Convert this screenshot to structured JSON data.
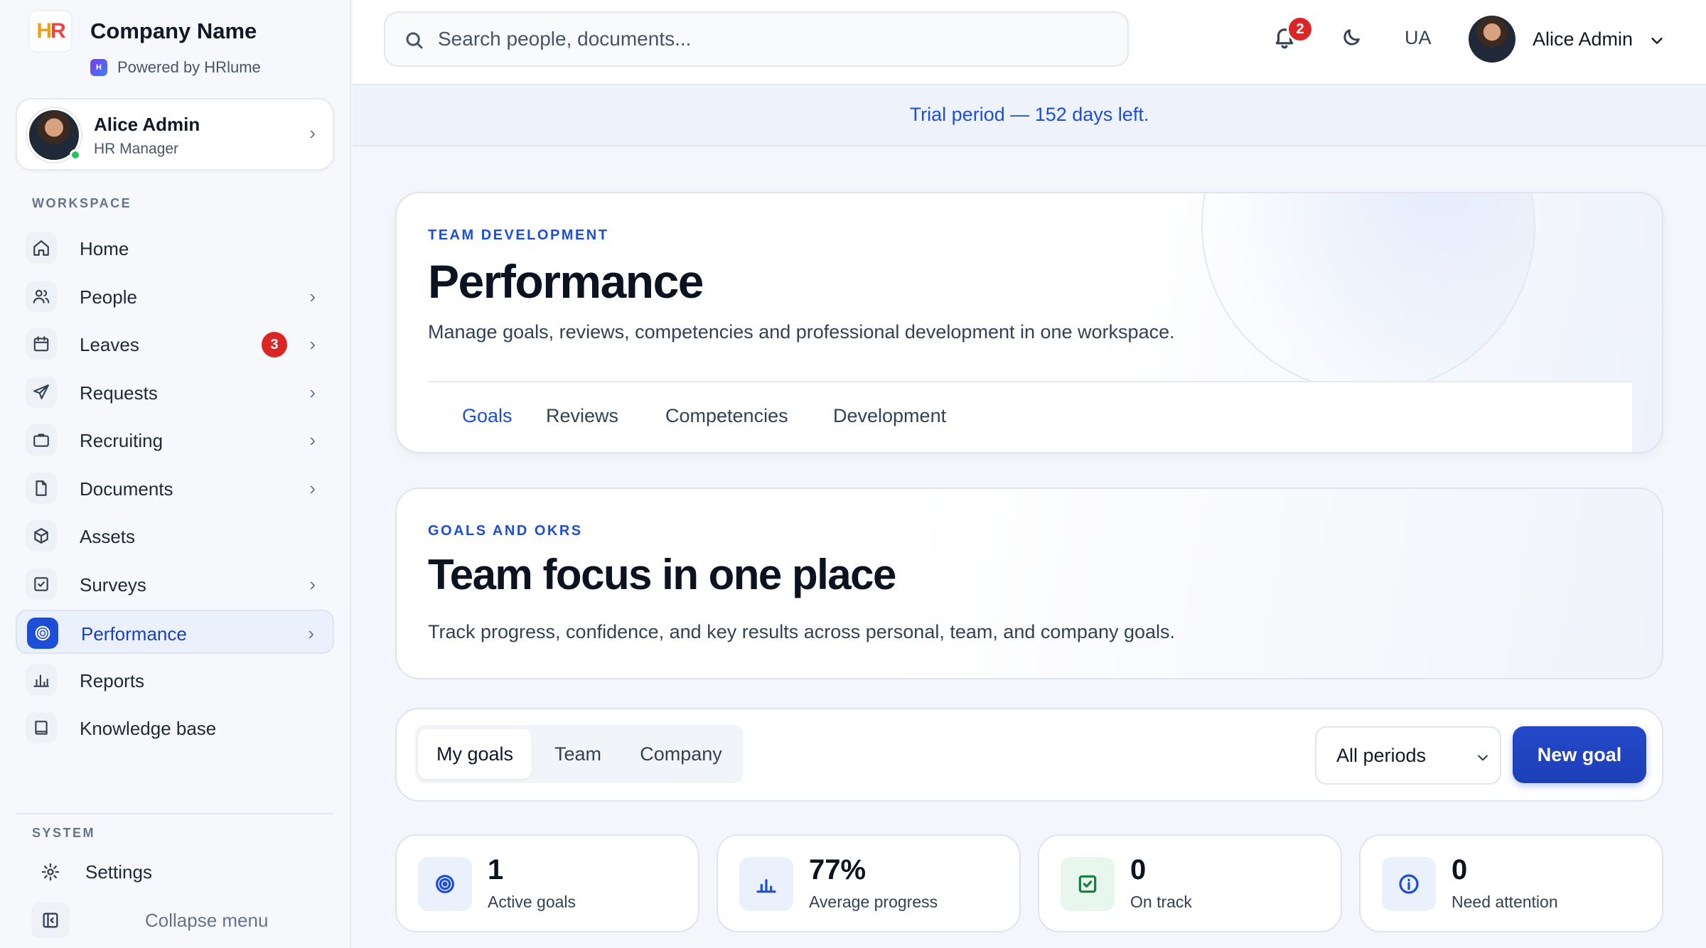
{
  "brand": {
    "logo_text": "HR",
    "name": "Company Name",
    "powered_by": "Powered by HRlume"
  },
  "sidebar": {
    "user": {
      "name": "Alice Admin",
      "role": "HR Manager"
    },
    "workspace_label": "WORKSPACE",
    "items": [
      {
        "label": "Home",
        "icon": "home-icon"
      },
      {
        "label": "People",
        "icon": "people-icon"
      },
      {
        "label": "Leaves",
        "icon": "calendar-icon",
        "badge": "3"
      },
      {
        "label": "Requests",
        "icon": "send-icon"
      },
      {
        "label": "Recruiting",
        "icon": "briefcase-icon"
      },
      {
        "label": "Documents",
        "icon": "document-icon"
      },
      {
        "label": "Assets",
        "icon": "box-icon"
      },
      {
        "label": "Surveys",
        "icon": "checkbox-icon"
      },
      {
        "label": "Performance",
        "icon": "target-icon",
        "active": true
      },
      {
        "label": "Reports",
        "icon": "bar-chart-icon"
      },
      {
        "label": "Knowledge base",
        "icon": "book-icon"
      }
    ],
    "system_label": "SYSTEM",
    "settings_label": "Settings",
    "collapse_label": "Collapse menu"
  },
  "topbar": {
    "search_placeholder": "Search people, documents...",
    "notifications_count": "2",
    "language": "UA",
    "user_name": "Alice Admin"
  },
  "trial_banner": "Trial period — 152 days left.",
  "hero": {
    "eyebrow": "TEAM DEVELOPMENT",
    "title": "Performance",
    "description": "Manage goals, reviews, competencies and professional development in one workspace.",
    "tabs": [
      "Goals",
      "Reviews",
      "Competencies",
      "Development"
    ],
    "active_tab": "Goals"
  },
  "okr": {
    "eyebrow": "GOALS AND OKRS",
    "title": "Team focus in one place",
    "description": "Track progress, confidence, and key results across personal, team, and company goals."
  },
  "filters": {
    "scopes": [
      "My goals",
      "Team",
      "Company"
    ],
    "active_scope": "My goals",
    "period": "All periods",
    "new_goal_label": "New goal"
  },
  "stats": [
    {
      "value": "1",
      "label": "Active goals",
      "icon": "target-icon"
    },
    {
      "value": "77%",
      "label": "Average progress",
      "icon": "bar-chart-icon"
    },
    {
      "value": "0",
      "label": "On track",
      "icon": "check-square-icon"
    },
    {
      "value": "0",
      "label": "Need attention",
      "icon": "info-icon"
    }
  ],
  "colors": {
    "accent": "#1d4ed8",
    "badge": "#dc2626",
    "success": "#15803d"
  }
}
